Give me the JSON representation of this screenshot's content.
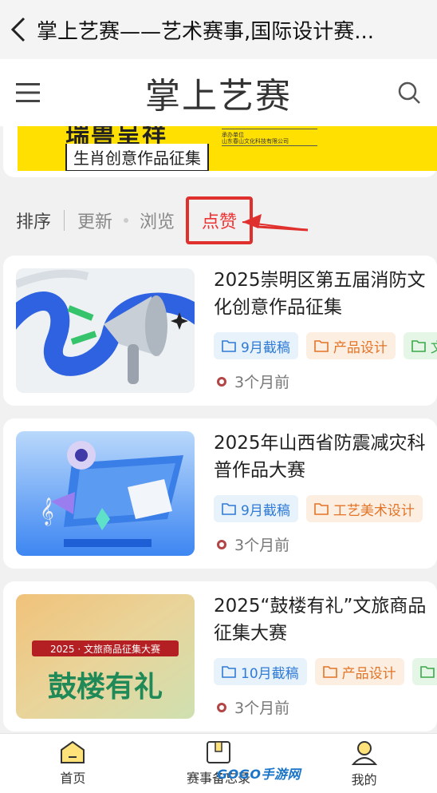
{
  "topbar": {
    "title": "掌上艺赛——艺术赛事,国际设计赛..."
  },
  "header": {
    "logo": "掌上艺赛"
  },
  "banner": {
    "title": "瑞兽呈祥",
    "subtitle": "生肖创意作品征集",
    "small_line1": "承办单位",
    "small_line2": "山东春山文化科技有限公司"
  },
  "sortbar": {
    "label": "排序",
    "options": [
      "更新",
      "浏览"
    ],
    "active": "点赞"
  },
  "cards": [
    {
      "title": "2025崇明区第五届消防文化创意作品征集",
      "tags": [
        {
          "label": "9月截稿",
          "color": "blue"
        },
        {
          "label": "产品设计",
          "color": "orange"
        },
        {
          "label": "文",
          "color": "green"
        }
      ],
      "time": "3个月前"
    },
    {
      "title": "2025年山西省防震减灾科普作品大赛",
      "tags": [
        {
          "label": "9月截稿",
          "color": "blue"
        },
        {
          "label": "工艺美术设计",
          "color": "orange"
        }
      ],
      "time": "3个月前"
    },
    {
      "title": "2025“鼓楼有礼”文旅商品征集大赛",
      "tags": [
        {
          "label": "10月截稿",
          "color": "blue"
        },
        {
          "label": "产品设计",
          "color": "orange"
        },
        {
          "label": "文",
          "color": "green"
        }
      ],
      "thumb_text_top": "2025 · 文旅商品征集大赛",
      "thumb_text_main": "鼓楼有礼",
      "time": "3个月前"
    }
  ],
  "bottomnav": {
    "items": [
      {
        "label": "首页",
        "icon": "home-icon"
      },
      {
        "label": "赛事备忘录",
        "icon": "memo-icon"
      },
      {
        "label": "我的",
        "icon": "profile-icon"
      }
    ]
  },
  "watermark": "GOGO手游网",
  "colors": {
    "accent_red": "#e0302e",
    "tag_blue": "#2f7bd6",
    "tag_orange": "#e37426",
    "banner_yellow": "#ffe000"
  }
}
